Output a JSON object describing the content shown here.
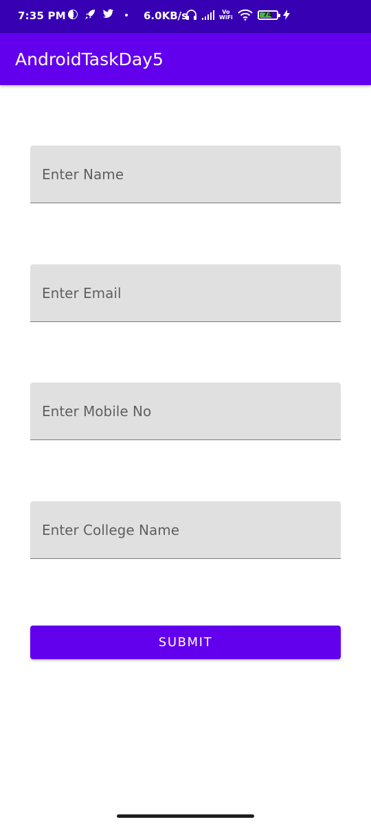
{
  "status_bar": {
    "time": "7:35 PM",
    "icons": [
      "app-notification-icon",
      "rocket-icon",
      "twitter-icon",
      "dot-icon"
    ],
    "net_speed": "6.0KB/s",
    "vowifi_top": "Vo",
    "vowifi_bottom": "WiFi",
    "battery_level": "74",
    "battery_fill_fraction": 0.74,
    "colors": {
      "background": "#3700b3",
      "battery": "#4caf50"
    }
  },
  "app_bar": {
    "title": "AndroidTaskDay5",
    "color": "#6200ee"
  },
  "form": {
    "fields": [
      {
        "placeholder": "Enter Name",
        "value": ""
      },
      {
        "placeholder": "Enter Email",
        "value": ""
      },
      {
        "placeholder": "Enter Mobile No",
        "value": ""
      },
      {
        "placeholder": "Enter College Name",
        "value": ""
      }
    ],
    "submit_label": "SUBMIT"
  }
}
